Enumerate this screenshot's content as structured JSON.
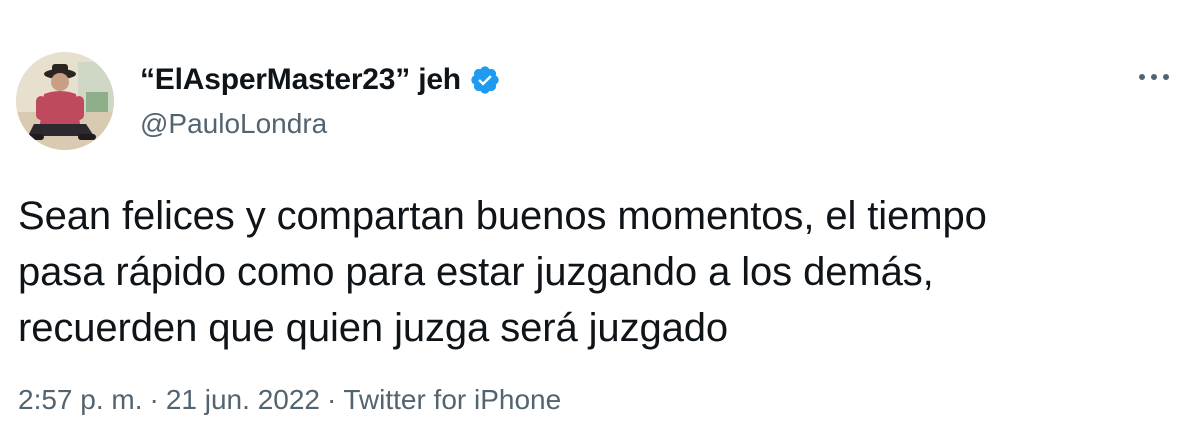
{
  "tweet": {
    "display_name": "“ElAsperMaster23” jeh",
    "handle": "@PauloLondra",
    "verified_icon": "verified-badge-icon",
    "more_icon": "more-options-icon",
    "text_lines": [
      "Sean felices y compartan buenos momentos, el tiempo",
      "pasa rápido como para estar juzgando a los demás,",
      "recuerden que quien juzga será juzgado"
    ],
    "time": "2:57 p. m.",
    "separator": "·",
    "date": "21 jun. 2022",
    "source": "Twitter for iPhone"
  },
  "colors": {
    "text": "#0f1419",
    "secondary": "#536471",
    "verified": "#1d9bf0",
    "background": "#ffffff"
  }
}
